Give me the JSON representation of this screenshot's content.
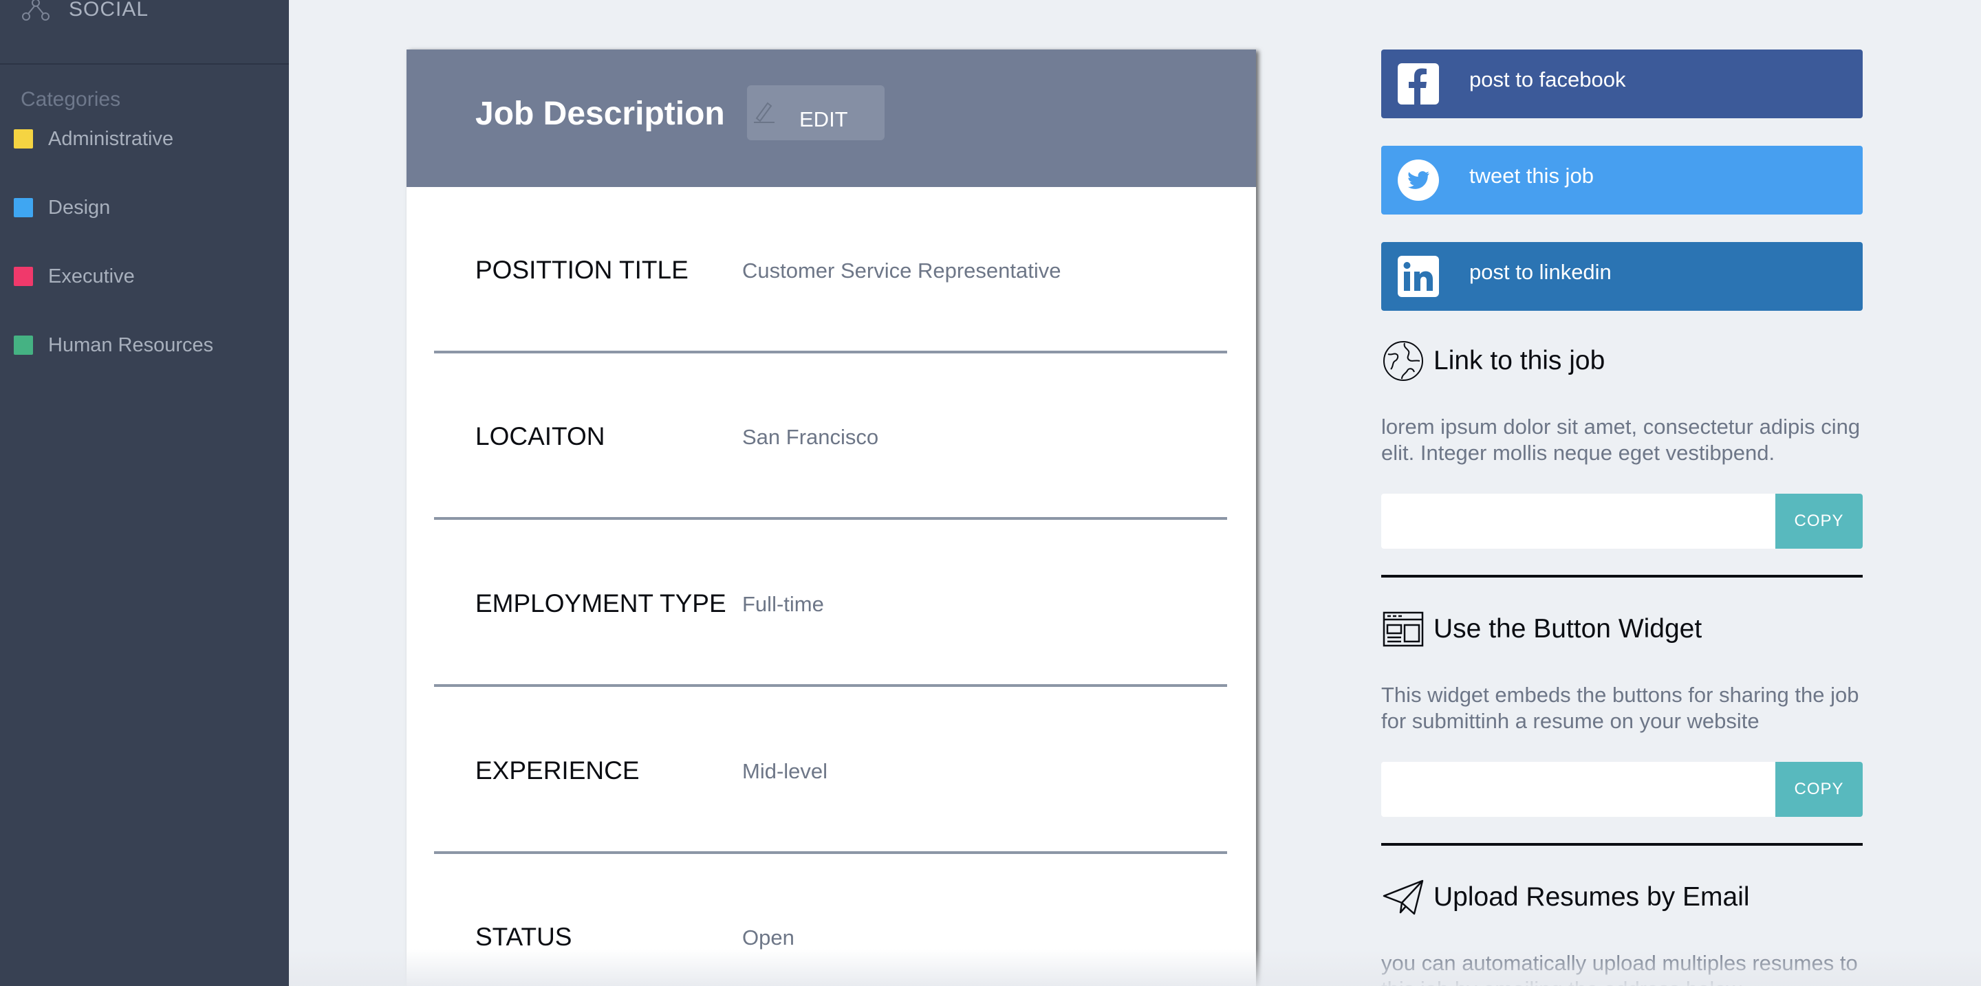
{
  "sidebar": {
    "social_label": "SOCIAL",
    "social_icon": "share-network-icon",
    "categories_title": "Categories",
    "categories": [
      {
        "label": "Administrative",
        "color": "#f5d442"
      },
      {
        "label": "Design",
        "color": "#3fa6f2"
      },
      {
        "label": "Executive",
        "color": "#f0396b"
      },
      {
        "label": "Human Resources",
        "color": "#45b283"
      }
    ]
  },
  "card": {
    "title": "Job Description",
    "edit_label": "EDIT",
    "edit_icon": "pencil-icon",
    "fields": [
      {
        "label": "POSITTION TITLE",
        "value": "Customer Service Representative"
      },
      {
        "label": "LOCAITON",
        "value": "San Francisco"
      },
      {
        "label": "EMPLOYMENT TYPE",
        "value": "Full-time"
      },
      {
        "label": "EXPERIENCE",
        "value": "Mid-level"
      },
      {
        "label": "STATUS",
        "value": "Open"
      }
    ]
  },
  "share": {
    "facebook": {
      "label": "post to facebook",
      "color": "#3c5a99",
      "icon": "facebook-icon"
    },
    "twitter": {
      "label": "tweet this job",
      "color": "#479ff0",
      "icon": "twitter-icon"
    },
    "linkedin": {
      "label": "post to linkedin",
      "color": "#2b74b3",
      "icon": "linkedin-icon"
    }
  },
  "link_section": {
    "title": "Link to this job",
    "icon": "globe-icon",
    "text": "lorem ipsum dolor sit amet, consectetur adipis cing elit. Integer mollis neque eget vestibpend.",
    "input_value": "",
    "copy_label": "COPY"
  },
  "widget_section": {
    "title": "Use the Button Widget",
    "icon": "browser-window-icon",
    "text": "This widget embeds the buttons for sharing the job for submittinh a resume on your website",
    "input_value": "",
    "copy_label": "COPY"
  },
  "email_section": {
    "title": "Upload Resumes by Email",
    "icon": "paper-plane-icon",
    "text": "you can automatically upload multiples resumes to this job by emailing the address below"
  },
  "colors": {
    "sidebar_bg": "#384153",
    "card_header_bg": "#727d95",
    "page_bg": "#edf0f4",
    "copy_button": "#58b9be"
  }
}
